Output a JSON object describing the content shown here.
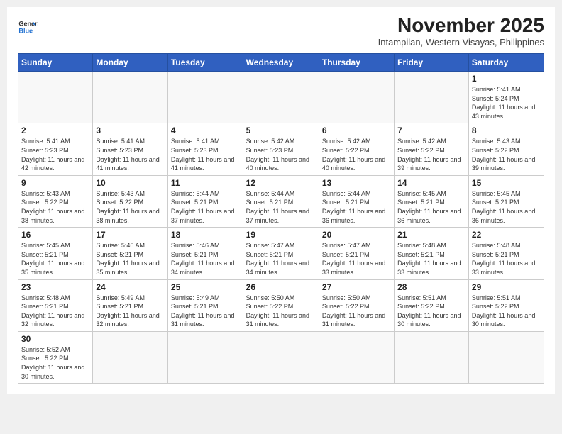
{
  "header": {
    "logo_general": "General",
    "logo_blue": "Blue",
    "month": "November 2025",
    "location": "Intampilan, Western Visayas, Philippines"
  },
  "weekdays": [
    "Sunday",
    "Monday",
    "Tuesday",
    "Wednesday",
    "Thursday",
    "Friday",
    "Saturday"
  ],
  "days": {
    "d1": {
      "num": "1",
      "sunrise": "5:41 AM",
      "sunset": "5:24 PM",
      "daylight": "11 hours and 43 minutes."
    },
    "d2": {
      "num": "2",
      "sunrise": "5:41 AM",
      "sunset": "5:23 PM",
      "daylight": "11 hours and 42 minutes."
    },
    "d3": {
      "num": "3",
      "sunrise": "5:41 AM",
      "sunset": "5:23 PM",
      "daylight": "11 hours and 41 minutes."
    },
    "d4": {
      "num": "4",
      "sunrise": "5:41 AM",
      "sunset": "5:23 PM",
      "daylight": "11 hours and 41 minutes."
    },
    "d5": {
      "num": "5",
      "sunrise": "5:42 AM",
      "sunset": "5:23 PM",
      "daylight": "11 hours and 40 minutes."
    },
    "d6": {
      "num": "6",
      "sunrise": "5:42 AM",
      "sunset": "5:22 PM",
      "daylight": "11 hours and 40 minutes."
    },
    "d7": {
      "num": "7",
      "sunrise": "5:42 AM",
      "sunset": "5:22 PM",
      "daylight": "11 hours and 39 minutes."
    },
    "d8": {
      "num": "8",
      "sunrise": "5:43 AM",
      "sunset": "5:22 PM",
      "daylight": "11 hours and 39 minutes."
    },
    "d9": {
      "num": "9",
      "sunrise": "5:43 AM",
      "sunset": "5:22 PM",
      "daylight": "11 hours and 38 minutes."
    },
    "d10": {
      "num": "10",
      "sunrise": "5:43 AM",
      "sunset": "5:22 PM",
      "daylight": "11 hours and 38 minutes."
    },
    "d11": {
      "num": "11",
      "sunrise": "5:44 AM",
      "sunset": "5:21 PM",
      "daylight": "11 hours and 37 minutes."
    },
    "d12": {
      "num": "12",
      "sunrise": "5:44 AM",
      "sunset": "5:21 PM",
      "daylight": "11 hours and 37 minutes."
    },
    "d13": {
      "num": "13",
      "sunrise": "5:44 AM",
      "sunset": "5:21 PM",
      "daylight": "11 hours and 36 minutes."
    },
    "d14": {
      "num": "14",
      "sunrise": "5:45 AM",
      "sunset": "5:21 PM",
      "daylight": "11 hours and 36 minutes."
    },
    "d15": {
      "num": "15",
      "sunrise": "5:45 AM",
      "sunset": "5:21 PM",
      "daylight": "11 hours and 36 minutes."
    },
    "d16": {
      "num": "16",
      "sunrise": "5:45 AM",
      "sunset": "5:21 PM",
      "daylight": "11 hours and 35 minutes."
    },
    "d17": {
      "num": "17",
      "sunrise": "5:46 AM",
      "sunset": "5:21 PM",
      "daylight": "11 hours and 35 minutes."
    },
    "d18": {
      "num": "18",
      "sunrise": "5:46 AM",
      "sunset": "5:21 PM",
      "daylight": "11 hours and 34 minutes."
    },
    "d19": {
      "num": "19",
      "sunrise": "5:47 AM",
      "sunset": "5:21 PM",
      "daylight": "11 hours and 34 minutes."
    },
    "d20": {
      "num": "20",
      "sunrise": "5:47 AM",
      "sunset": "5:21 PM",
      "daylight": "11 hours and 33 minutes."
    },
    "d21": {
      "num": "21",
      "sunrise": "5:48 AM",
      "sunset": "5:21 PM",
      "daylight": "11 hours and 33 minutes."
    },
    "d22": {
      "num": "22",
      "sunrise": "5:48 AM",
      "sunset": "5:21 PM",
      "daylight": "11 hours and 33 minutes."
    },
    "d23": {
      "num": "23",
      "sunrise": "5:48 AM",
      "sunset": "5:21 PM",
      "daylight": "11 hours and 32 minutes."
    },
    "d24": {
      "num": "24",
      "sunrise": "5:49 AM",
      "sunset": "5:21 PM",
      "daylight": "11 hours and 32 minutes."
    },
    "d25": {
      "num": "25",
      "sunrise": "5:49 AM",
      "sunset": "5:21 PM",
      "daylight": "11 hours and 31 minutes."
    },
    "d26": {
      "num": "26",
      "sunrise": "5:50 AM",
      "sunset": "5:22 PM",
      "daylight": "11 hours and 31 minutes."
    },
    "d27": {
      "num": "27",
      "sunrise": "5:50 AM",
      "sunset": "5:22 PM",
      "daylight": "11 hours and 31 minutes."
    },
    "d28": {
      "num": "28",
      "sunrise": "5:51 AM",
      "sunset": "5:22 PM",
      "daylight": "11 hours and 30 minutes."
    },
    "d29": {
      "num": "29",
      "sunrise": "5:51 AM",
      "sunset": "5:22 PM",
      "daylight": "11 hours and 30 minutes."
    },
    "d30": {
      "num": "30",
      "sunrise": "5:52 AM",
      "sunset": "5:22 PM",
      "daylight": "11 hours and 30 minutes."
    }
  },
  "labels": {
    "sunrise": "Sunrise:",
    "sunset": "Sunset:",
    "daylight": "Daylight:"
  }
}
